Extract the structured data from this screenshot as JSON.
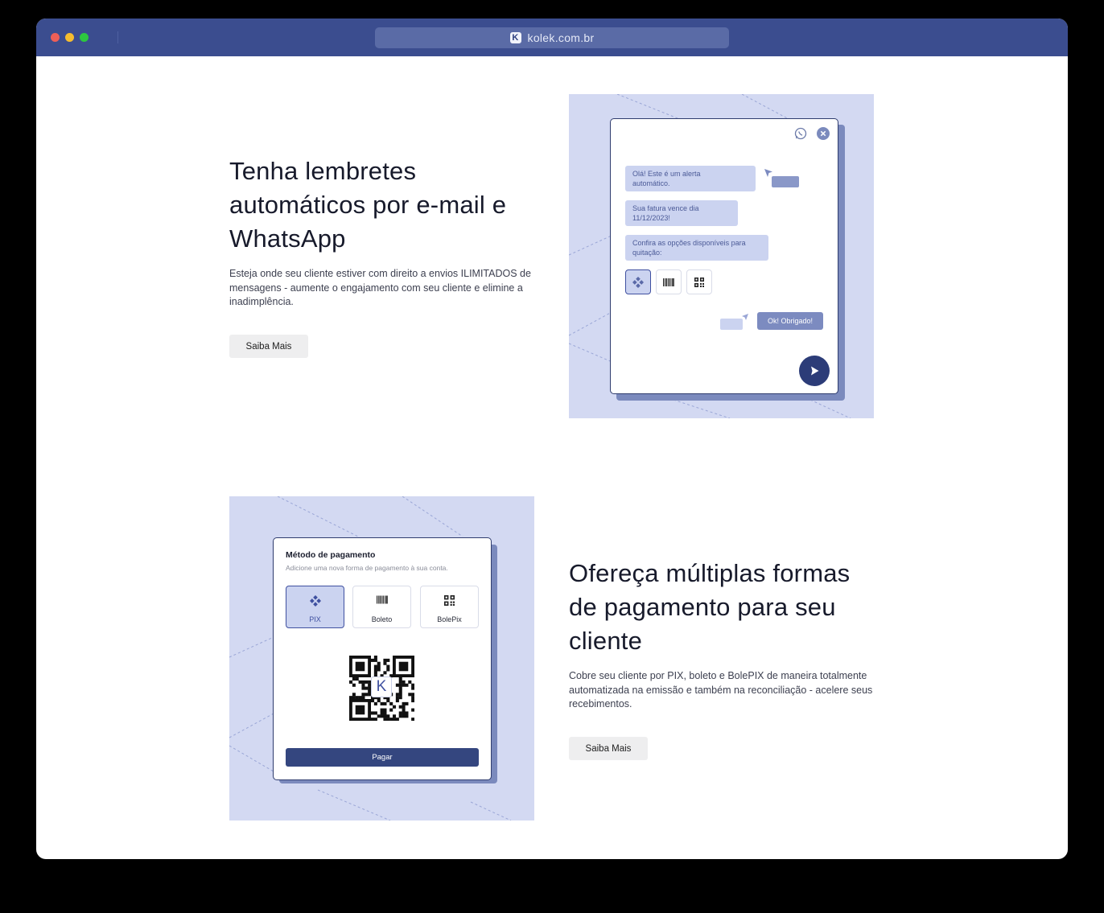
{
  "browser": {
    "url": "kolek.com.br",
    "favicon_letter": "K"
  },
  "section1": {
    "heading_lines": [
      "Tenha lembretes",
      "automáticos por e-mail e",
      "WhatsApp"
    ],
    "description_lines": [
      "Esteja onde seu cliente estiver com direito a envios ILIMITADOS de",
      "mensagens - aumente o engajamento com seu cliente e elimine a",
      "inadimplência."
    ],
    "button": "Saiba Mais"
  },
  "chat_mock": {
    "bubbles": [
      [
        "Olá! Este é um alerta",
        "automático."
      ],
      [
        "Sua fatura vence dia",
        "11/12/2023!"
      ],
      [
        "Confira as opções disponíveis para",
        "quitação:"
      ]
    ],
    "reply": "Ok! Obrigado!",
    "icons": [
      "whatsapp-icon",
      "close-icon",
      "pix-icon",
      "barcode-icon",
      "qr-icon",
      "send-icon"
    ]
  },
  "section2": {
    "heading_lines": [
      "Ofereça múltiplas formas",
      "de pagamento para seu",
      "cliente"
    ],
    "description_lines": [
      "Cobre seu cliente por PIX, boleto e BolePIX de maneira totalmente",
      "automatizada na emissão e também na reconciliação - acelere seus",
      "recebimentos."
    ],
    "button": "Saiba Mais"
  },
  "payment_mock": {
    "title": "Método de pagamento",
    "subtitle": "Adicione uma nova forma de pagamento à sua conta.",
    "methods": [
      {
        "label": "PIX",
        "icon": "pix-icon",
        "selected": true
      },
      {
        "label": "Boleto",
        "icon": "barcode-icon",
        "selected": false
      },
      {
        "label": "BolePix",
        "icon": "qr-icon",
        "selected": false
      }
    ],
    "qr_logo_letter": "K",
    "pay_button": "Pagar"
  },
  "colors": {
    "titlebar": "#3b4d8f",
    "accent": "#3f50a0",
    "illustration_bg": "#d3d9f2",
    "bubble": "#cbd3f0",
    "dark_button": "#2c3c78"
  }
}
